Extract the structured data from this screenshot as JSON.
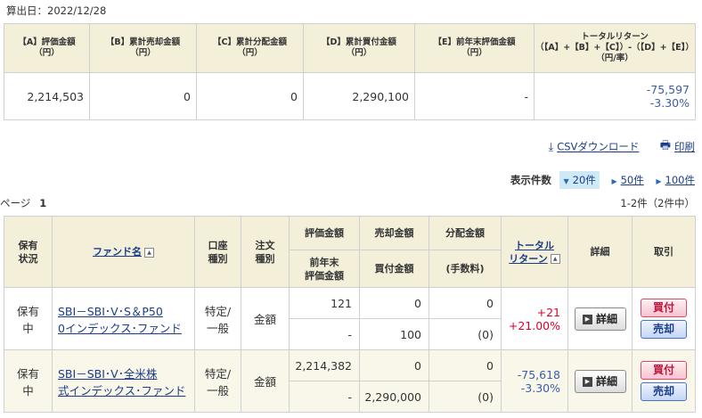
{
  "calc_date": "算出日：2022/12/28",
  "summary": {
    "headers": [
      [
        "【A】評価金額",
        "（円）"
      ],
      [
        "【B】累計売却金額",
        "（円）"
      ],
      [
        "【C】累計分配金額",
        "（円）"
      ],
      [
        "【D】累計買付金額",
        "（円）"
      ],
      [
        "【E】前年末評価金額",
        "（円）"
      ],
      [
        "トータルリターン",
        "（【A】+【B】+【C】）-（【D】+【E】）",
        "（円/率）"
      ]
    ],
    "values": [
      "2,214,503",
      "0",
      "0",
      "2,290,100",
      "-"
    ],
    "total_amount": "-75,597",
    "total_rate": "-3.30%"
  },
  "tools": {
    "csv": "CSVダウンロード",
    "print": "印刷"
  },
  "display": {
    "label": "表示件数",
    "selected": "20件",
    "opt50": "50件",
    "opt100": "100件"
  },
  "page": {
    "label": "ページ",
    "number": "1"
  },
  "count": "1-2件（2件中）",
  "fund_headers": {
    "status": [
      "保有",
      "状況"
    ],
    "name": "ファンド名",
    "account": [
      "口座",
      "種別"
    ],
    "order": [
      "注文",
      "種別"
    ],
    "eval": "評価金額",
    "prev_eval": [
      "前年末",
      "評価金額"
    ],
    "sell": "売却金額",
    "buy": "買付金額",
    "dist": "分配金額",
    "fee": "(手数料)",
    "total_return": [
      "トータル",
      "リターン"
    ],
    "detail": "詳細",
    "trade": "取引"
  },
  "buttons": {
    "detail": "詳細",
    "buy": "買付",
    "sell": "売却"
  },
  "funds": [
    {
      "status": [
        "保有",
        "中"
      ],
      "name": [
        "SBI－SBI･V･S＆P50",
        "0インデックス･ファンド"
      ],
      "account": [
        "特定/",
        "一般"
      ],
      "order": "金額",
      "eval": "121",
      "prev_eval": "-",
      "sell": "0",
      "buy": "100",
      "dist": "0",
      "fee": "(0)",
      "return_amount": "+21",
      "return_rate": "+21.00%"
    },
    {
      "status": [
        "保有",
        "中"
      ],
      "name": [
        "SBI－SBI･V･全米株",
        "式インデックス･ファンド"
      ],
      "account": [
        "特定/",
        "一般"
      ],
      "order": "金額",
      "eval": "2,214,382",
      "prev_eval": "-",
      "sell": "0",
      "buy": "2,290,000",
      "dist": "0",
      "fee": "(0)",
      "return_amount": "-75,618",
      "return_rate": "-3.30%"
    }
  ]
}
